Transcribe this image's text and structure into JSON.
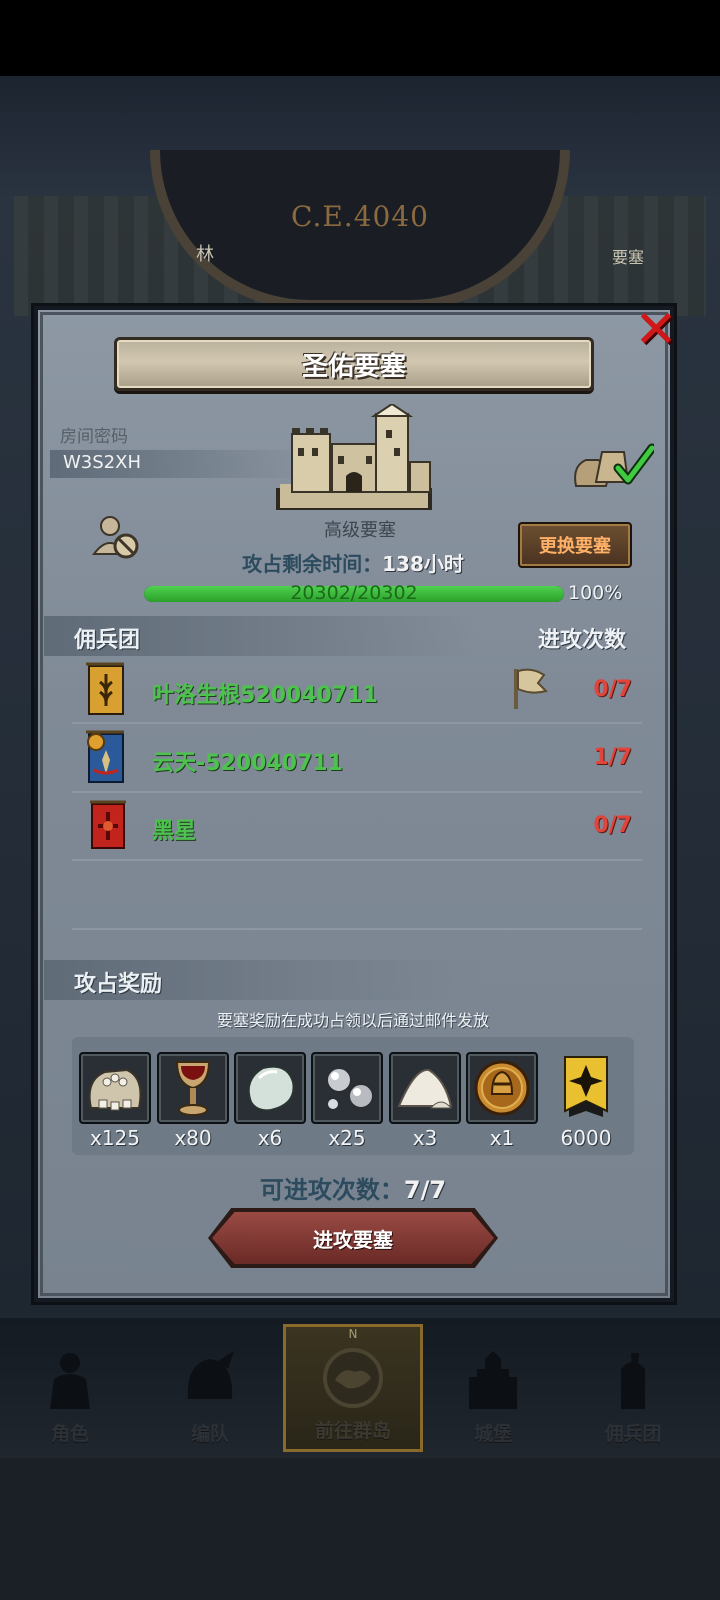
{
  "map": {
    "era_label": "C.E.4040",
    "tag_left": "林",
    "tag_right": "要塞"
  },
  "dialog": {
    "title": "圣佑要塞",
    "room_label": "房间密码",
    "room_code": "W3S2XH",
    "fortress_type": "高级要塞",
    "swap_button": "更换要塞",
    "time_label": "攻占剩余时间：",
    "time_value": "138小时",
    "hp_text": "20302/20302",
    "hp_percent": "100%",
    "hp_fraction": 1.0,
    "icons": {
      "close": "close-icon",
      "loot": "loot-bags-check-icon",
      "no_person": "person-blocked-icon",
      "castle": "castle-icon",
      "flag": "flag-icon"
    }
  },
  "mercenaries": {
    "header_title": "佣兵团",
    "header_attacks": "进攻次数",
    "rows": [
      {
        "name": "叶洛生根520040711",
        "count": "0/7",
        "banner": "wheat-banner-icon",
        "banner_color": "#d8a030"
      },
      {
        "name": "云天-520040711",
        "count": "1/7",
        "banner": "sun-banner-icon",
        "banner_color": "#2a5a9a"
      },
      {
        "name": "黑星",
        "count": "0/7",
        "banner": "cross-banner-icon",
        "banner_color": "#c0241c"
      }
    ]
  },
  "rewards": {
    "title": "攻占奖励",
    "hint": "要塞奖励在成功占领以后通过邮件发放",
    "items": [
      {
        "icon": "grain-sack-icon",
        "count": "x125"
      },
      {
        "icon": "goblet-icon",
        "count": "x80"
      },
      {
        "icon": "moonstone-icon",
        "count": "x6"
      },
      {
        "icon": "silver-ore-icon",
        "count": "x25"
      },
      {
        "icon": "salt-pile-icon",
        "count": "x3"
      },
      {
        "icon": "knight-medal-icon",
        "count": "x1"
      },
      {
        "icon": "rank-banner-icon",
        "count": "6000"
      }
    ]
  },
  "attack": {
    "label": "可进攻次数：",
    "value": "7/7",
    "button": "进攻要塞"
  },
  "nav": {
    "tabs": [
      {
        "label": "角色",
        "icon": "knight-icon",
        "active": false
      },
      {
        "label": "编队",
        "icon": "helmet-icon",
        "active": false
      },
      {
        "label": "前往群岛",
        "icon": "compass-map-icon",
        "active": true
      },
      {
        "label": "城堡",
        "icon": "castle-tab-icon",
        "active": false
      },
      {
        "label": "佣兵团",
        "icon": "mercenary-icon",
        "active": false
      }
    ],
    "compass_letter": "N"
  },
  "colors": {
    "name_green": "#4ec24e",
    "count_red": "#e0443a",
    "accent_orange": "#ffb067",
    "hp_green": "#2aa02a"
  }
}
